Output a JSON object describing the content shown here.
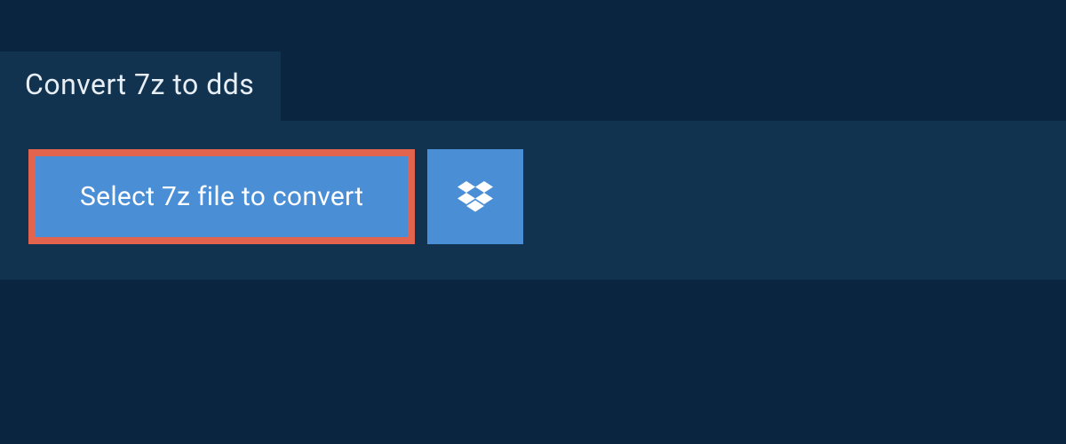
{
  "tab": {
    "title": "Convert 7z to dds"
  },
  "actions": {
    "select_file_label": "Select 7z file to convert"
  }
}
